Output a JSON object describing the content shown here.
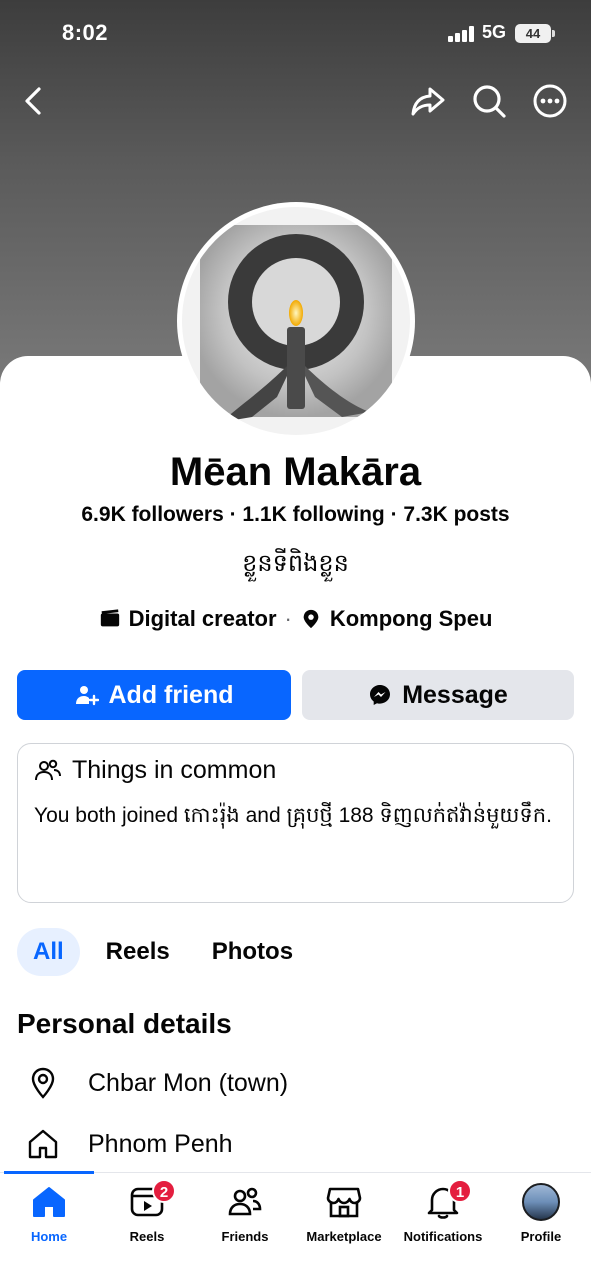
{
  "status_bar": {
    "time": "8:02",
    "network": "5G",
    "battery": "44"
  },
  "profile": {
    "name": "Mēan Makāra",
    "stats": "6.9K followers · 1.1K following · 7.3K posts",
    "bio": "ខ្លួនទីពិងខ្លួន",
    "category": "Digital creator",
    "location": "Kompong Speu"
  },
  "actions": {
    "add_friend": "Add friend",
    "message": "Message"
  },
  "common": {
    "title": "Things in common",
    "text_prefix": "You both joined ",
    "group1": "កោះរ៉ុង",
    "text_mid": " and ",
    "group2": "គ្រុបថ្មី 188 ទិញលក់ឥវ៉ាន់មួយទឹក",
    "text_suffix": "."
  },
  "tabs": [
    "All",
    "Reels",
    "Photos"
  ],
  "personal_details": {
    "title": "Personal details",
    "lives": "Chbar Mon (town)",
    "from": "Phnom Penh"
  },
  "nav": {
    "home": "Home",
    "reels": "Reels",
    "reels_badge": "2",
    "friends": "Friends",
    "marketplace": "Marketplace",
    "notifications": "Notifications",
    "notifications_badge": "1",
    "profile": "Profile"
  },
  "colors": {
    "accent": "#0866ff",
    "badge": "#e41e3f"
  }
}
